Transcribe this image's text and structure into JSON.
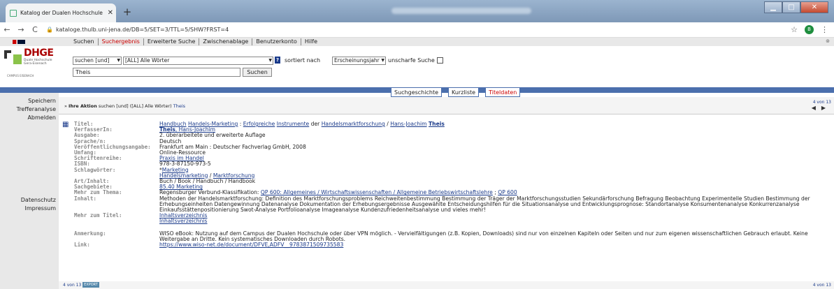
{
  "browser": {
    "tab_title": "Katalog der Dualen Hochschule :",
    "tab_close": "✕",
    "new_tab": "+",
    "back": "←",
    "forward": "→",
    "reload": "C",
    "url": "kataloge.thulb.uni-jena.de/DB=5/SET=3/TTL=5/SHW?FRST=4",
    "star": "☆",
    "avatar_letter": "B",
    "menu": "⋮"
  },
  "menubar": {
    "items": [
      "Suchen",
      "Suchergebnis",
      "Erweiterte Suche",
      "Zwischenablage",
      "Benutzerkonto",
      "Hilfe"
    ]
  },
  "logo": {
    "brand": "DHGE",
    "subtitle": "Duale Hochschule Gera-Eisenach",
    "campus": "CAMPUS EISENACH"
  },
  "search": {
    "mode": "suchen [und]",
    "index": "[ALL] Alle Wörter",
    "sort_label": "sortiert nach",
    "sort_value": "Erscheinungsjahr",
    "fuzzy_label": "unscharfe Suche",
    "query": "Theis",
    "button": "Suchen",
    "help": "?"
  },
  "subtabs": [
    "Suchgeschichte",
    "Kurzliste",
    "Titeldaten"
  ],
  "sidebar": {
    "top": [
      "Speichern",
      "Trefferanalyse",
      "Abmelden"
    ],
    "bottom": [
      "Datenschutz",
      "Impressum"
    ]
  },
  "action": {
    "label": "Ihre Aktion",
    "text": "suchen [und] ([ALL] Alle Wörter)",
    "term": "Theis",
    "pager": "4 von 13",
    "prev": "◀",
    "next": "▶"
  },
  "record": {
    "titel_label": "Titel:",
    "titel_parts": [
      "Handbuch",
      "Handels-Marketing",
      ":",
      "Erfolgreiche",
      "Instrumente",
      "der",
      "Handelsmarktforschung",
      "/",
      "Hans-Joachim",
      "Theis"
    ],
    "verfasser_label": "VerfasserIn:",
    "verfasser_bold": "Theis",
    "verfasser_rest": ", Hans-Joachim",
    "ausgabe_label": "Ausgabe:",
    "ausgabe": "2. überarbeitete und erweiterte Auflage",
    "sprache_label": "Sprache/n:",
    "sprache": "Deutsch",
    "veroeff_label": "Veröffentlichungsangabe:",
    "veroeff": "Frankfurt am Main : Deutscher Fachverlag GmbH, 2008",
    "umfang_label": "Umfang:",
    "umfang": "Online-Ressource",
    "reihe_label": "Schriftenreihe:",
    "reihe": "Praxis im Handel",
    "isbn_label": "ISBN:",
    "isbn": "978-3-87150-973-5",
    "schlag_label": "Schlagwörter:",
    "schlag1_prefix": "*",
    "schlag1": "Marketing",
    "schlag2a": "Handelsmarketing",
    "schlag2sep": " / ",
    "schlag2b": "Marktforschung",
    "art_label": "Art/Inhalt:",
    "art": "Buch / Book / Handbuch / Handbook",
    "sach_label": "Sachgebiete:",
    "sach": "85.40 Marketing",
    "mehr_thema_label": "Mehr zum Thema:",
    "mehr_thema_prefix": "Regensburger Verbund-Klassifikation: ",
    "mehr_thema_link1": "QP 600: Allgemeines / Wirtschaftswissenschaften / Allgemeine Betriebswirtschaftslehre",
    "mehr_thema_sep": " ; ",
    "mehr_thema_link2": "QP 600",
    "inhalt_label": "Inhalt:",
    "inhalt": "Methoden der Handelsmarktforschung: Definition des Marktforschungsproblems Reichweitenbestimmung Bestimmung der Träger der Marktforschungsstudien Sekundärforschung Befragung Beobachtung Experimentelle Studien Bestimmung der Erhebungseinheiten Datengewinnung Datenanalyse Dokumentation der Erhebungsergebnisse Ausgewählte Entscheidungshilfen für die Situationsanalyse und Entwicklungsprognose: Standortanalyse Konsumentenanalyse Konkurrenzanalyse Einkaufsstättenpositionierung Swot-Analyse Portfolioanalyse Imageanalyse Kundenzufriedenheitsanalyse und vieles mehr!",
    "mehr_titel_label": "Mehr zum Titel:",
    "mehr_titel1": "Inhaltsverzeichnis",
    "mehr_titel2": "Inhaltsverzeichnis",
    "anmerkung_label": "Anmerkung:",
    "anmerkung": "WISO eBook: Nutzung auf dem Campus der Dualen Hochschule oder über VPN möglich. - Vervielfältigungen (z.B. Kopien, Downloads) sind nur von einzelnen Kapiteln oder Seiten und nur zum eigenen wissenschaftlichen Gebrauch erlaubt. Keine Weitergabe an Dritte. Kein systematisches Downloaden durch Robots.",
    "link_label": "Link:",
    "link": "https://www.wiso-net.de/document/DFVE,ADFV__9783871509735583"
  },
  "footer": {
    "left": "4 von 13",
    "badge": "EXPORT",
    "right": "4 von 13"
  }
}
